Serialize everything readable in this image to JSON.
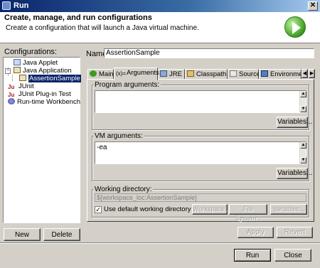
{
  "window": {
    "title": "Run"
  },
  "header": {
    "title": "Create, manage, and run configurations",
    "subtitle": "Create a configuration that will launch a Java virtual machine."
  },
  "configurations": {
    "label": "Configurations:",
    "tree": [
      {
        "label": "Java Applet",
        "icon": "applet-icon"
      },
      {
        "label": "Java Application",
        "icon": "java-app-icon",
        "expanded": true
      },
      {
        "label": "AssertionSample",
        "icon": "java-app-icon",
        "selected": true
      },
      {
        "label": "JUnit",
        "icon": "junit-icon"
      },
      {
        "label": "JUnit Plug-in Test",
        "icon": "junit-plugin-icon"
      },
      {
        "label": "Run-time Workbench",
        "icon": "workbench-icon"
      }
    ],
    "new_label": "New",
    "delete_label": "Delete"
  },
  "name_field": {
    "label": "Name:",
    "value": "AssertionSample"
  },
  "tabs": [
    {
      "label": "Main",
      "icon": "main-icon"
    },
    {
      "label": "Arguments",
      "icon": "arguments-icon",
      "selected": true
    },
    {
      "label": "JRE",
      "icon": "jre-icon"
    },
    {
      "label": "Classpath",
      "icon": "classpath-icon"
    },
    {
      "label": "Source",
      "icon": "source-icon"
    },
    {
      "label": "Environment",
      "icon": "environment-icon"
    }
  ],
  "program_args": {
    "label": "Program arguments:",
    "value": "",
    "variables_label": "Variables..."
  },
  "vm_args": {
    "label": "VM arguments:",
    "value": "-ea",
    "variables_label": "Variables..."
  },
  "working_dir": {
    "label": "Working directory:",
    "value": "${workspace_loc:AssertionSample}",
    "use_default_label": "Use default working directory",
    "use_default_checked": true,
    "workspace_label": "Workspace...",
    "filesystem_label": "File System...",
    "variables_label": "Variables..."
  },
  "actions": {
    "apply_label": "Apply",
    "revert_label": "Revert"
  },
  "footer": {
    "run_label": "Run",
    "close_label": "Close"
  },
  "colors": {
    "titlebar": "#0a246a",
    "selection": "#0a246a",
    "dialog_bg": "#d4d0c8"
  }
}
